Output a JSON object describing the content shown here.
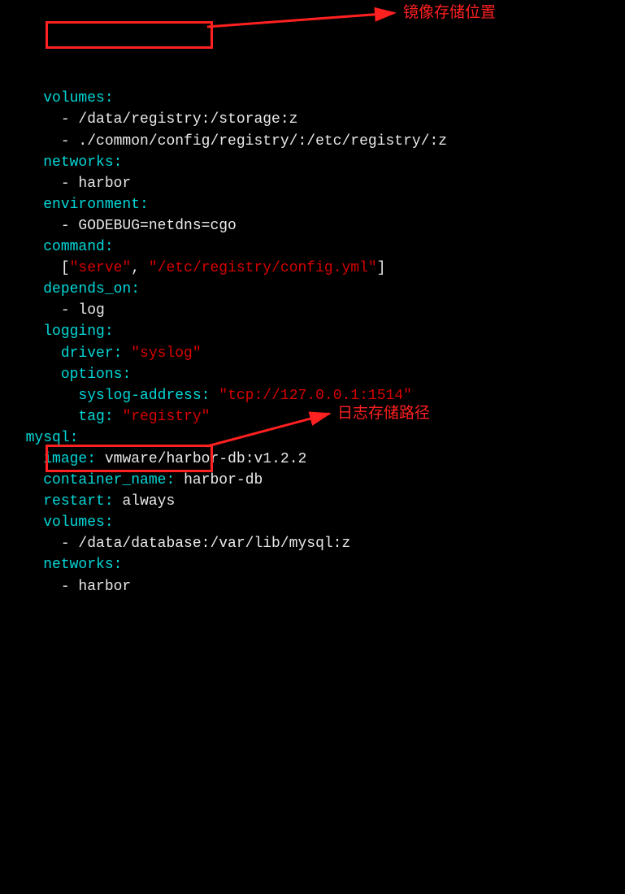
{
  "lines": {
    "l1_key": "volumes",
    "l2_dash": "- ",
    "l2_text": "/data/registry:/storage:z",
    "l3_dash": "- ",
    "l3_text": "./common/config/registry/:/etc/registry/:z",
    "l4_key": "networks",
    "l5_dash": "- ",
    "l5_text": "harbor",
    "l6_key": "environment",
    "l7_dash": "- ",
    "l7_text": "GODEBUG=netdns=cgo",
    "l8_key": "command",
    "l9_open": "[",
    "l9_s1": "\"serve\"",
    "l9_comma": ", ",
    "l9_s2": "\"/etc/registry/config.yml\"",
    "l9_close": "]",
    "l10_key": "depends_on",
    "l11_dash": "- ",
    "l11_text": "log",
    "l12_key": "logging",
    "l13_key": "driver",
    "l13_val": "\"syslog\"",
    "l14_key": "options",
    "l15_key": "syslog-address",
    "l15_val": "\"tcp://127.0.0.1:1514\"",
    "l16_key": "tag",
    "l16_val": "\"registry\"",
    "l17_key": "mysql",
    "l18_key": "image",
    "l18_val": "vmware/harbor-db:v1.2.2",
    "l19_key": "container_name",
    "l19_val": "harbor-db",
    "l20_key": "restart",
    "l20_val": "always",
    "l21_key": "volumes",
    "l22_dash": "- ",
    "l22_text": "/data/database:/var/lib/mysql:z",
    "l23_key": "networks",
    "l24_dash": "- ",
    "l24_text": "harbor"
  },
  "annotations": {
    "a1": "镜像存储位置",
    "a2": "日志存储路径"
  }
}
